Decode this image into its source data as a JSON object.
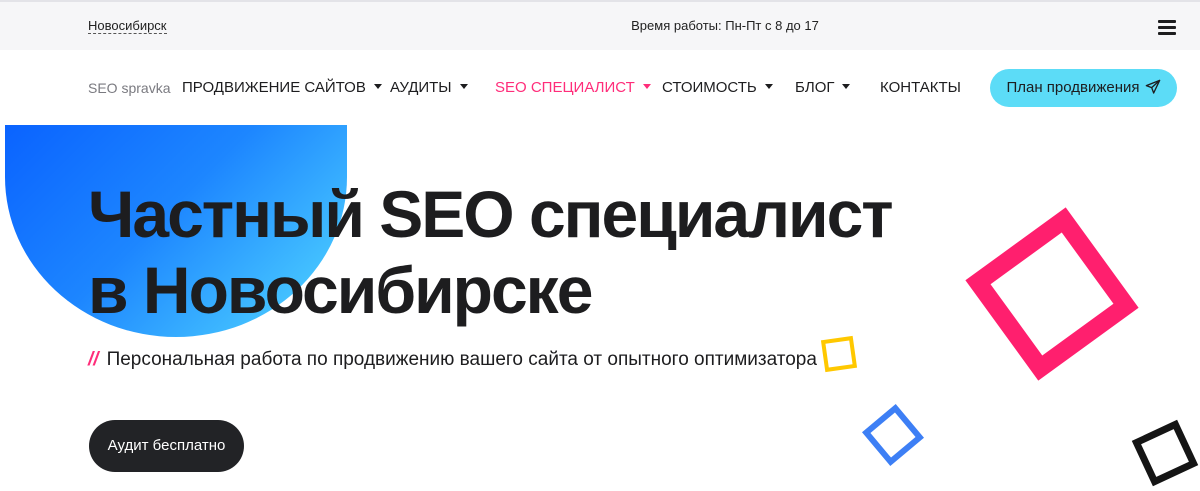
{
  "topbar": {
    "city": "Новосибирск",
    "work_hours": "Время работы: Пн-Пт с 8 до 17",
    "menu_icon": "hamburger-icon"
  },
  "nav": {
    "logo": "SEO spravka",
    "items": [
      {
        "label": "ПРОДВИЖЕНИЕ САЙТОВ",
        "dropdown": true
      },
      {
        "label": "АУДИТЫ",
        "dropdown": true
      },
      {
        "label": "SEO СПЕЦИАЛИСТ",
        "dropdown": true,
        "active": true
      },
      {
        "label": "СТОИМОСТЬ",
        "dropdown": true
      },
      {
        "label": "БЛОГ",
        "dropdown": true
      },
      {
        "label": "КОНТАКТЫ",
        "dropdown": false
      }
    ],
    "cta_label": "План продвижения",
    "cta_icon": "paper-plane-icon"
  },
  "hero": {
    "title_line1": "Частный SEO специалист",
    "title_line2": "в Новосибирске",
    "subtitle_marker": "//",
    "subtitle": "Персональная работа по продвижению вашего сайта от опытного оптимизатора",
    "button_label": "Аудит бесплатно"
  },
  "colors": {
    "accent_pink": "#ff2d7a",
    "cta_cyan": "#5cdcf7",
    "dark_button": "#222326",
    "shape_yellow": "#ffc800",
    "shape_blue": "#3d7ff5",
    "blob_gradient_start": "#0a63ff",
    "blob_gradient_end": "#55dcff"
  }
}
